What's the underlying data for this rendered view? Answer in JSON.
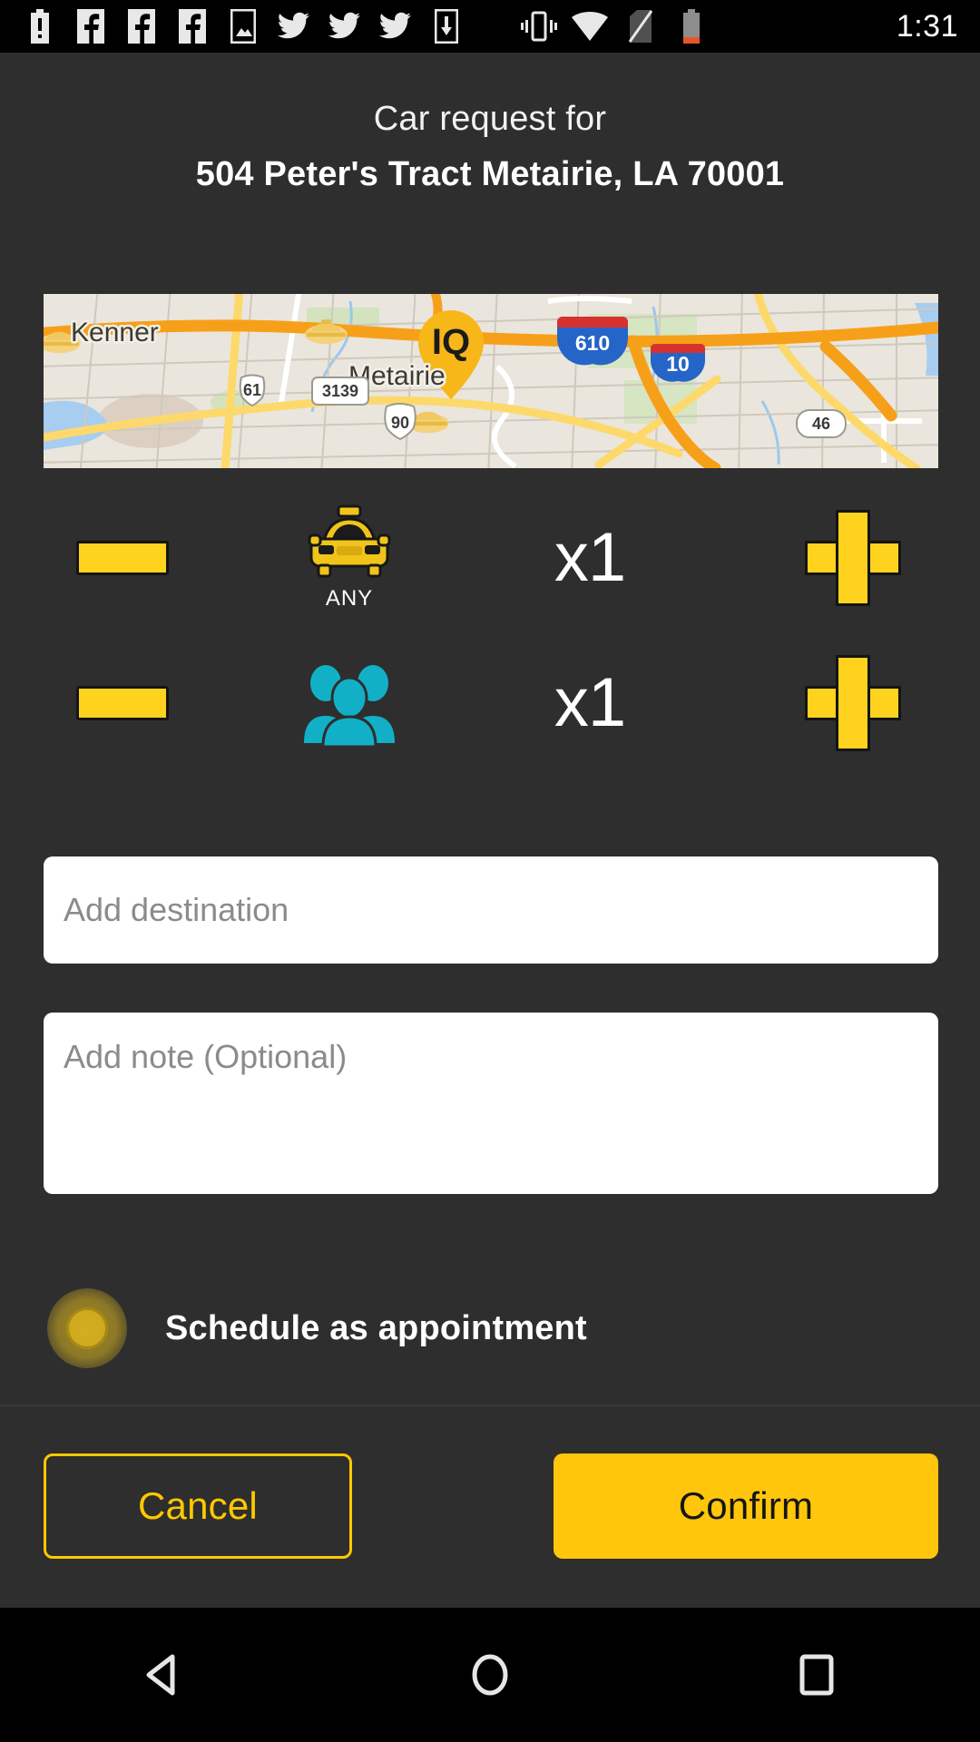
{
  "status_bar": {
    "time": "1:31",
    "icons": [
      {
        "name": "battery-alert-icon"
      },
      {
        "name": "facebook-icon"
      },
      {
        "name": "facebook-icon"
      },
      {
        "name": "facebook-icon"
      },
      {
        "name": "image-icon"
      },
      {
        "name": "twitter-icon"
      },
      {
        "name": "twitter-icon"
      },
      {
        "name": "twitter-icon"
      },
      {
        "name": "download-icon"
      },
      {
        "name": "vibrate-icon"
      },
      {
        "name": "wifi-icon"
      },
      {
        "name": "no-sim-icon"
      },
      {
        "name": "battery-low-icon"
      }
    ]
  },
  "header": {
    "line1": "Car request for",
    "line2": "504 Peter's Tract Metairie, LA 70001"
  },
  "map": {
    "city_labels": [
      "Kenner",
      "Metairie"
    ],
    "interstate_shields": [
      "610",
      "10"
    ],
    "road_shields": [
      "61",
      "3139",
      "90",
      "46"
    ],
    "pin_label": "IQ",
    "vehicle_markers": 3,
    "colors": {
      "land": "#eae6dd",
      "highway": "#f6a01a",
      "arterial": "#fdd96b",
      "water": "#a7cdf0",
      "park": "#cfe3b8",
      "pin": "#f7b719",
      "interstate_blue": "#2565c7",
      "interstate_red": "#d6322f"
    }
  },
  "counters": [
    {
      "id": "taxi",
      "icon": "taxi-icon",
      "icon_label": "ANY",
      "count": "x1",
      "minus_label": "",
      "plus_label": ""
    },
    {
      "id": "passengers",
      "icon": "passengers-icon",
      "icon_label": "",
      "count": "x1",
      "minus_label": "",
      "plus_label": ""
    }
  ],
  "fields": {
    "destination_placeholder": "Add destination",
    "destination_value": "",
    "note_placeholder": "Add note (Optional)",
    "note_value": ""
  },
  "schedule": {
    "label": "Schedule as appointment",
    "checked": false
  },
  "footer": {
    "cancel_label": "Cancel",
    "confirm_label": "Confirm"
  },
  "nav_bar": {
    "back": "back-icon",
    "home": "home-icon",
    "recents": "recents-icon"
  },
  "colors": {
    "background": "#2e2e2e",
    "accent_yellow": "#ffc60b",
    "minus_plus_yellow": "#ffd21e",
    "passenger_cyan": "#12b0c6",
    "text_white": "#ffffff",
    "placeholder_gray": "#8b8b8b"
  }
}
